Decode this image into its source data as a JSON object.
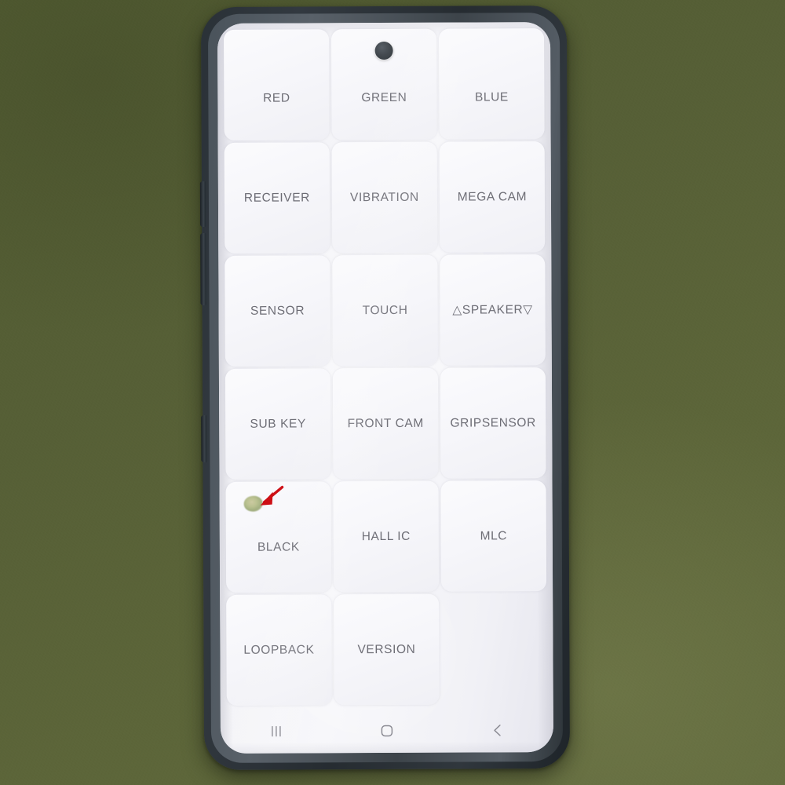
{
  "scene": {
    "background_color": "#565f36",
    "description_alt": "Samsung phone displaying hardware self-test menu"
  },
  "device": {
    "frame_color": "#2a3137",
    "rim_color": "#4a535b",
    "side_keys": [
      {
        "name": "volume-up-key"
      },
      {
        "name": "volume-down-key"
      },
      {
        "name": "power-key"
      }
    ],
    "camera": {
      "name": "punch-hole-front-camera",
      "color": "#3e444a"
    }
  },
  "screen": {
    "background_color": "#f3f3f7",
    "cell_color": "#f7f7fa",
    "label_color": "#6d6d75"
  },
  "test_grid": {
    "columns": 3,
    "cells": [
      {
        "label": "RED",
        "key": "red",
        "row": 1,
        "empty": false,
        "defect": false
      },
      {
        "label": "GREEN",
        "key": "green",
        "row": 1,
        "empty": false,
        "defect": false
      },
      {
        "label": "BLUE",
        "key": "blue",
        "row": 1,
        "empty": false,
        "defect": false
      },
      {
        "label": "RECEIVER",
        "key": "receiver",
        "row": 2,
        "empty": false,
        "defect": false
      },
      {
        "label": "VIBRATION",
        "key": "vibration",
        "row": 2,
        "empty": false,
        "defect": false
      },
      {
        "label": "MEGA CAM",
        "key": "mega-cam",
        "row": 2,
        "empty": false,
        "defect": false
      },
      {
        "label": "SENSOR",
        "key": "sensor",
        "row": 3,
        "empty": false,
        "defect": false
      },
      {
        "label": "TOUCH",
        "key": "touch",
        "row": 3,
        "empty": false,
        "defect": false
      },
      {
        "label": "△SPEAKER▽",
        "key": "speaker",
        "row": 3,
        "empty": false,
        "defect": false
      },
      {
        "label": "SUB KEY",
        "key": "sub-key",
        "row": 4,
        "empty": false,
        "defect": false
      },
      {
        "label": "FRONT CAM",
        "key": "front-cam",
        "row": 4,
        "empty": false,
        "defect": false
      },
      {
        "label": "GRIPSENSOR",
        "key": "gripsensor",
        "row": 4,
        "empty": false,
        "defect": false
      },
      {
        "label": "BLACK",
        "key": "black",
        "row": 5,
        "empty": false,
        "defect": true
      },
      {
        "label": "HALL IC",
        "key": "hall-ic",
        "row": 5,
        "empty": false,
        "defect": false
      },
      {
        "label": "MLC",
        "key": "mlc",
        "row": 5,
        "empty": false,
        "defect": false
      },
      {
        "label": "LOOPBACK",
        "key": "loopback",
        "row": 6,
        "empty": false,
        "defect": false
      },
      {
        "label": "VERSION",
        "key": "version",
        "row": 6,
        "empty": false,
        "defect": false
      },
      {
        "label": "",
        "key": "blank",
        "row": 6,
        "empty": true,
        "defect": false
      }
    ]
  },
  "annotation": {
    "arrow_color": "#cc0a10",
    "target_cell": "BLACK",
    "blemish_color": "#a8b27e"
  },
  "nav_bar": {
    "buttons": [
      {
        "icon": "recents-icon",
        "label": "Recents"
      },
      {
        "icon": "home-icon",
        "label": "Home"
      },
      {
        "icon": "back-icon",
        "label": "Back"
      }
    ],
    "icon_color": "#8b8b93"
  }
}
